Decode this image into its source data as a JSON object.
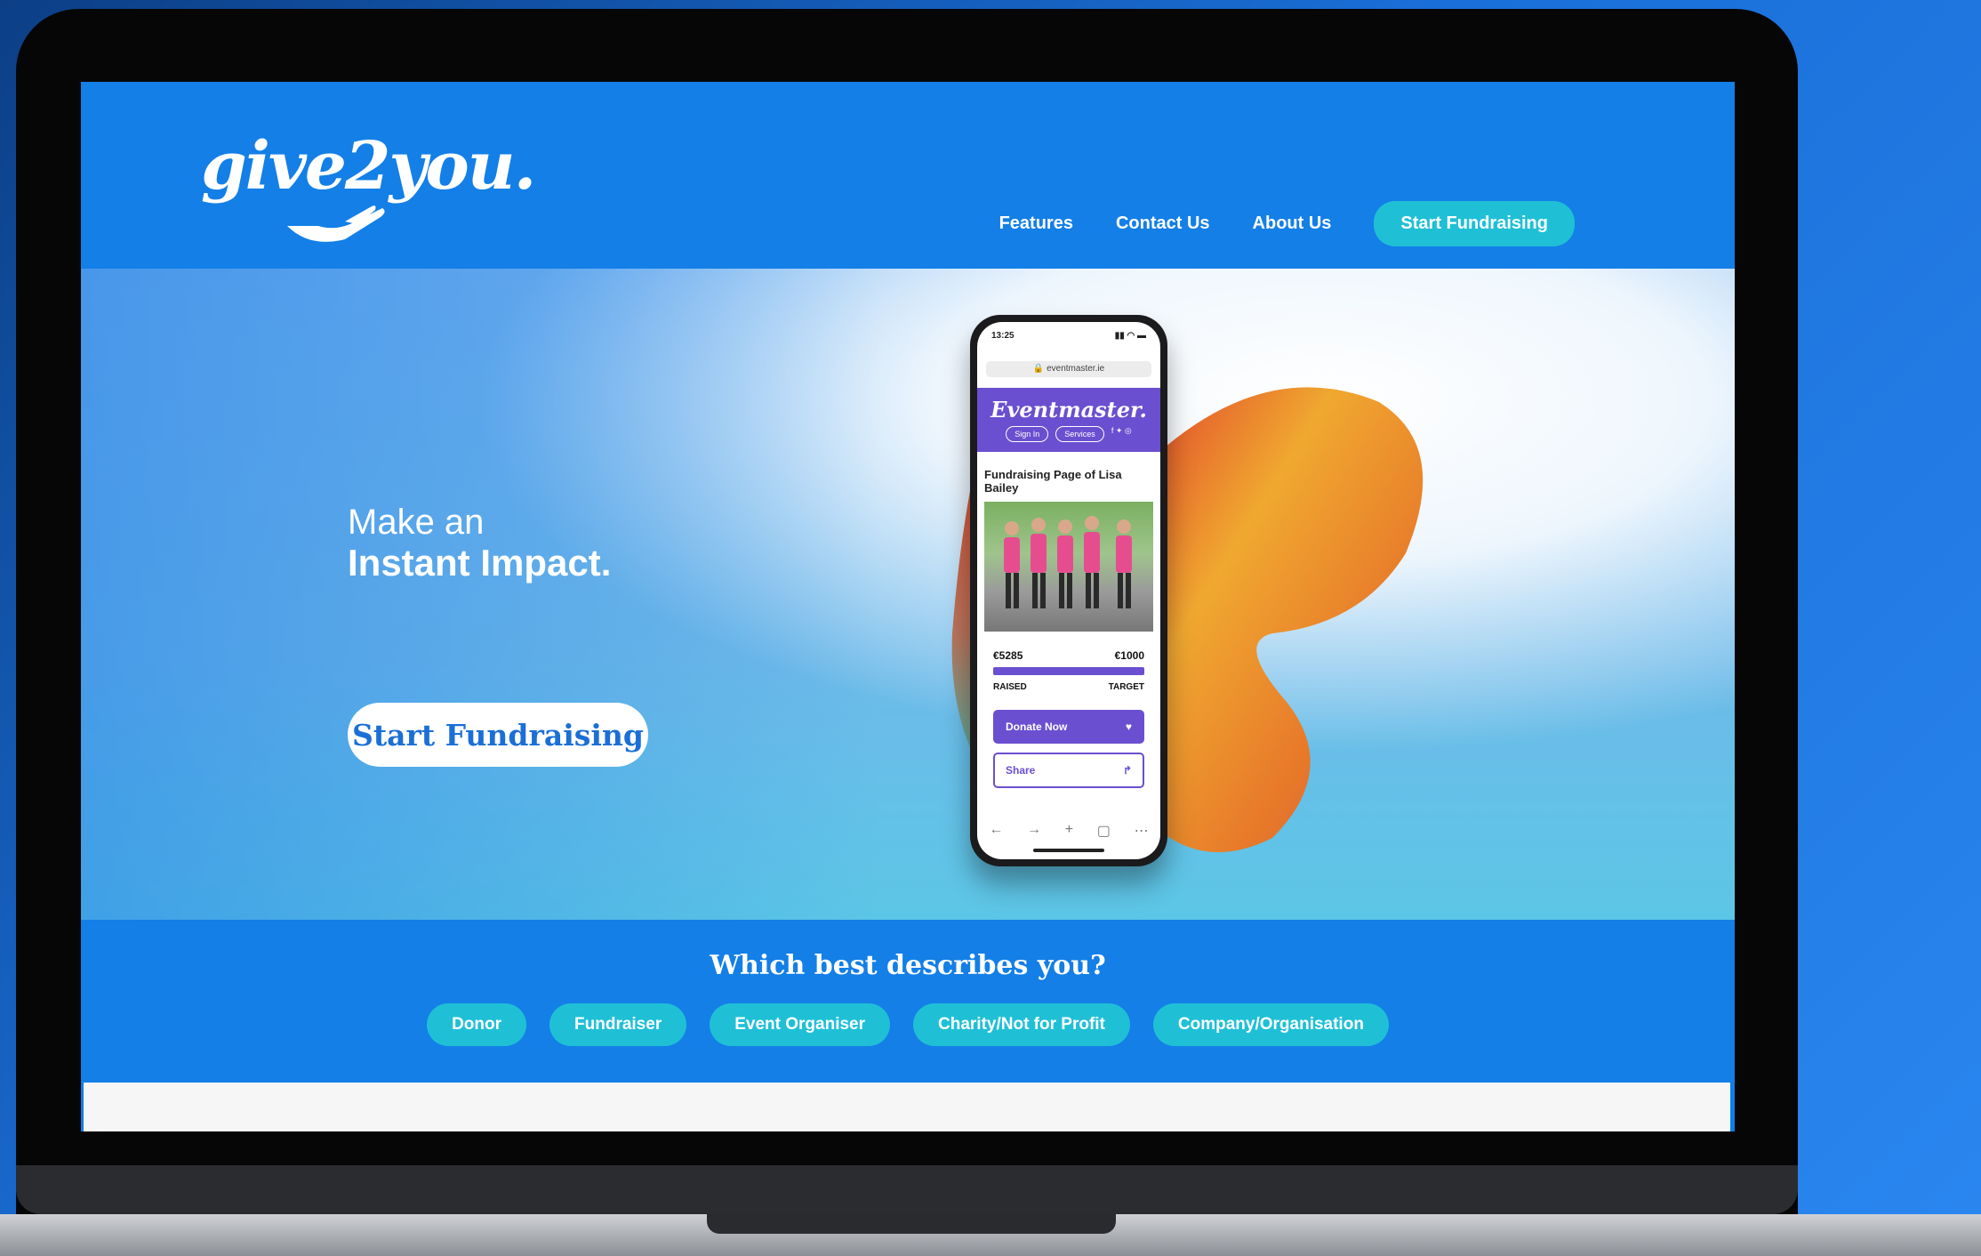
{
  "logo": {
    "text": "give2you."
  },
  "nav": {
    "links": [
      "Features",
      "Contact Us",
      "About Us"
    ],
    "cta": "Start Fundraising"
  },
  "hero": {
    "line1": "Make an",
    "line2": "Instant Impact.",
    "cta": "Start Fundraising"
  },
  "phone": {
    "time": "13:25",
    "url": "eventmaster.ie",
    "brand": "Eventmaster.",
    "sign_in": "Sign In",
    "services": "Services",
    "page_title": "Fundraising Page of Lisa Bailey",
    "raised_amount": "€5285",
    "target_amount": "€1000",
    "raised_label": "RAISED",
    "target_label": "TARGET",
    "donate": "Donate Now",
    "share": "Share"
  },
  "describe": {
    "title": "Which best describes you?",
    "options": [
      "Donor",
      "Fundraiser",
      "Event Organiser",
      "Charity/Not for Profit",
      "Company/Organisation"
    ]
  },
  "colors": {
    "brand_blue": "#137fe7",
    "accent_teal": "#1fc0d6",
    "phone_purple": "#6a4fd0"
  }
}
